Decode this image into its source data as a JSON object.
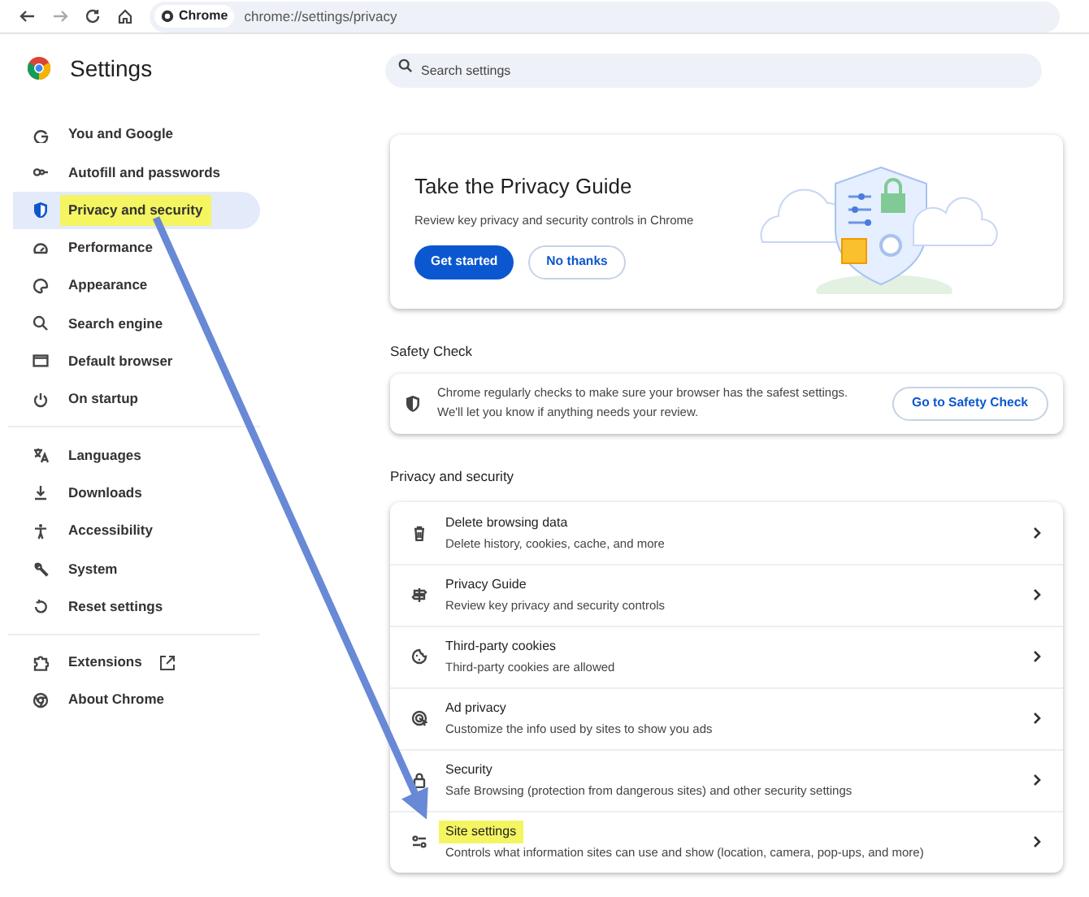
{
  "toolbar": {
    "chip": "Chrome",
    "url": "chrome://settings/privacy"
  },
  "header": {
    "title": "Settings",
    "search": {
      "placeholder": "Search settings"
    }
  },
  "sidebar": {
    "groups": [
      [
        {
          "label": "You and Google",
          "selected": false,
          "highlighted": false,
          "external": false
        },
        {
          "label": "Autofill and passwords",
          "selected": false,
          "highlighted": false,
          "external": false
        },
        {
          "label": "Privacy and security",
          "selected": true,
          "highlighted": true,
          "external": false
        },
        {
          "label": "Performance",
          "selected": false,
          "highlighted": false,
          "external": false
        },
        {
          "label": "Appearance",
          "selected": false,
          "highlighted": false,
          "external": false
        },
        {
          "label": "Search engine",
          "selected": false,
          "highlighted": false,
          "external": false
        },
        {
          "label": "Default browser",
          "selected": false,
          "highlighted": false,
          "external": false
        },
        {
          "label": "On startup",
          "selected": false,
          "highlighted": false,
          "external": false
        }
      ],
      [
        {
          "label": "Languages",
          "selected": false,
          "highlighted": false,
          "external": false
        },
        {
          "label": "Downloads",
          "selected": false,
          "highlighted": false,
          "external": false
        },
        {
          "label": "Accessibility",
          "selected": false,
          "highlighted": false,
          "external": false
        },
        {
          "label": "System",
          "selected": false,
          "highlighted": false,
          "external": false
        },
        {
          "label": "Reset settings",
          "selected": false,
          "highlighted": false,
          "external": false
        }
      ],
      [
        {
          "label": "Extensions",
          "selected": false,
          "highlighted": false,
          "external": true
        },
        {
          "label": "About Chrome",
          "selected": false,
          "highlighted": false,
          "external": false
        }
      ]
    ]
  },
  "privacy_guide": {
    "title": "Take the Privacy Guide",
    "description": "Review key privacy and security controls in Chrome",
    "buttons": [
      {
        "label": "Get started",
        "primary": true
      },
      {
        "label": "No thanks",
        "primary": false
      }
    ]
  },
  "safety_check": {
    "heading": "Safety Check",
    "text": "Chrome regularly checks to make sure your browser has the safest settings. We'll let you know if anything needs your review.",
    "button": "Go to Safety Check"
  },
  "privacy_section": {
    "heading": "Privacy and security",
    "rows": [
      {
        "title": "Delete browsing data",
        "subtitle": "Delete history, cookies, cache, and more",
        "highlighted": false
      },
      {
        "title": "Privacy Guide",
        "subtitle": "Review key privacy and security controls",
        "highlighted": false
      },
      {
        "title": "Third-party cookies",
        "subtitle": "Third-party cookies are allowed",
        "highlighted": false
      },
      {
        "title": "Ad privacy",
        "subtitle": "Customize the info used by sites to show you ads",
        "highlighted": false
      },
      {
        "title": "Security",
        "subtitle": "Safe Browsing (protection from dangerous sites) and other security settings",
        "highlighted": false
      },
      {
        "title": "Site settings",
        "subtitle": "Controls what information sites can use and show (location, camera, pop-ups, and more)",
        "highlighted": true
      }
    ]
  }
}
